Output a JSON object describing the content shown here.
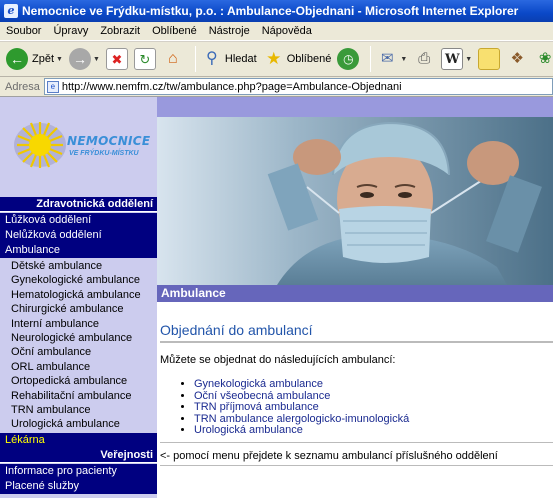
{
  "window": {
    "title": "Nemocnice ve Frýdku-místku, p.o. : Ambulance-Objednani - Microsoft Internet Explorer"
  },
  "menubar": {
    "items": [
      "Soubor",
      "Úpravy",
      "Zobrazit",
      "Oblíbené",
      "Nástroje",
      "Nápověda"
    ]
  },
  "toolbar": {
    "back_label": "Zpět",
    "search_label": "Hledat",
    "favorites_label": "Oblíbené"
  },
  "addressbar": {
    "label": "Adresa",
    "url": "http://www.nemfm.cz/tw/ambulance.php?page=Ambulance-Objednani"
  },
  "logo": {
    "name": "NEMOCNICE",
    "sub": "VE FRÝDKU-MÍSTKU"
  },
  "sidebar": {
    "section1_title": "Zdravotnická oddělení",
    "main_items": [
      "Lůžková oddělení",
      "Nelůžková oddělení",
      "Ambulance"
    ],
    "sub_items": [
      "Dětské ambulance",
      "Gynekologické ambulance",
      "Hematologická ambulance",
      "Chirurgické ambulance",
      "Interní ambulance",
      "Neurologické ambulance",
      "Oční ambulance",
      "ORL ambulance",
      "Ortopedická ambulance",
      "Rehabilitační ambulance",
      "TRN ambulance",
      "Urologická ambulance"
    ],
    "pharmacy": "Lékárna",
    "section2_title": "Veřejnosti",
    "public_items": [
      "Informace pro pacienty",
      "Placené služby"
    ]
  },
  "content": {
    "section_bar": "Ambulance",
    "title": "Objednání do ambulancí",
    "intro": "Můžete se objednat do následujících ambulancí:",
    "links": [
      "Gynekologická ambulance",
      "Oční všeobecná ambulance",
      "TRN příjmová ambulance",
      "TRN ambulance alergologicko-imunologická",
      "Urologická ambulance"
    ],
    "back_note": "<- pomocí menu přejdete k seznamu ambulancí příslušného oddělení"
  },
  "colors": {
    "nav_dark": "#000080",
    "sidebar_bg": "#ccccee",
    "section_bar": "#6666bb",
    "title_blue": "#2255aa",
    "link_blue": "#1a2a90",
    "highlight_yellow": "#ffff00"
  }
}
